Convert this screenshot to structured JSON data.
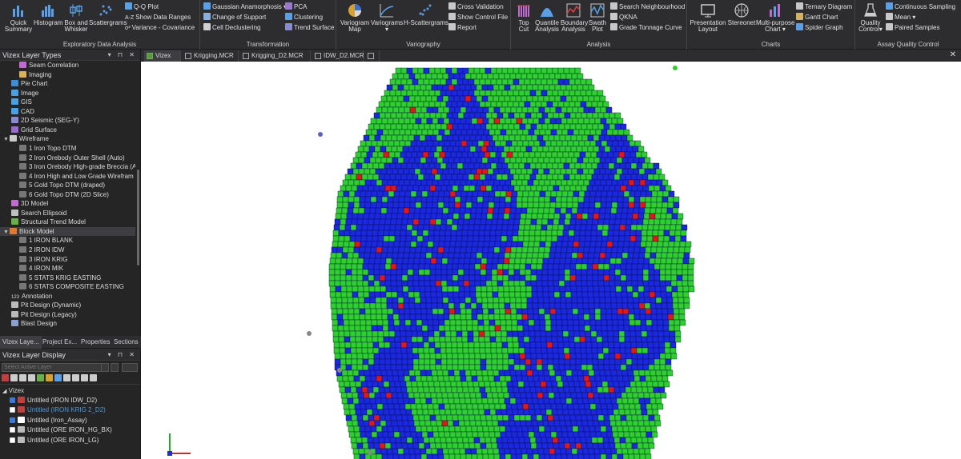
{
  "ribbon": {
    "eda": {
      "label": "Exploratory Data Analysis",
      "quick": "Quick",
      "quick2": "Summary",
      "histogram": "Histogram",
      "box": "Box and",
      "box2": "Whisker",
      "scatter": "Scattergrams",
      "qq": "Q-Q Plot",
      "ranges": "Show Data Ranges",
      "ranges_prefix": "A-Z",
      "varcov": "Variance - Covariance",
      "varcov_prefix": "σ²"
    },
    "transformation": {
      "label": "Transformation",
      "gauss": "Gaussian Anamorphosis",
      "support": "Change of Support",
      "declust": "Cell Declustering",
      "pca": "PCA",
      "clustering": "Clustering",
      "trend": "Trend Surface"
    },
    "variography": {
      "label": "Variography",
      "map": "Variogram",
      "map2": "Map",
      "variograms": "Variograms",
      "hscatter": "H-Scattergrams",
      "crossval": "Cross Validation",
      "control": "Show Control File",
      "report": "Report"
    },
    "analysis": {
      "label": "Analysis",
      "topcut": "Top",
      "topcut2": "Cut",
      "quantile": "Quantile",
      "quantile2": "Analysis",
      "boundary": "Boundary",
      "boundary2": "Analysis",
      "swath": "Swath",
      "swath2": "Plot",
      "search": "Search Neighbourhood",
      "qkna": "QKNA",
      "grade": "Grade Tonnage Curve"
    },
    "charts": {
      "label": "Charts",
      "presentation": "Presentation",
      "presentation2": "Layout",
      "stereonet": "Stereonet",
      "multi": "Multi-purpose",
      "multi2": "Chart",
      "ternary": "Ternary Diagram",
      "gantt": "Gantt Chart",
      "spider": "Spider Graph"
    },
    "aqc": {
      "label": "Assay Quality Control",
      "quality": "Quality",
      "quality2": "Control",
      "continuous": "Continuous Sampling",
      "mean": "Mean",
      "paired": "Paired Samples"
    }
  },
  "layer_types": {
    "title": "Vizex Layer Types",
    "controls": "▾ ⊓ ✕",
    "items": [
      {
        "label": "Seam Correlation",
        "indent": 2,
        "color": "#c06bd0"
      },
      {
        "label": "Imaging",
        "indent": 2,
        "color": "#d8b060"
      },
      {
        "label": "Pie Chart",
        "indent": 1,
        "color": "#3b8fd8"
      },
      {
        "label": "Image",
        "indent": 1,
        "color": "#4aa0e0"
      },
      {
        "label": "GIS",
        "indent": 1,
        "color": "#4aa0e0"
      },
      {
        "label": "CAD",
        "indent": 1,
        "color": "#4aa0e0"
      },
      {
        "label": "2D Seismic (SEG-Y)",
        "indent": 1,
        "color": "#8a8ad0"
      },
      {
        "label": "Grid Surface",
        "indent": 1,
        "color": "#9a6ad0"
      },
      {
        "label": "Wireframe",
        "indent": 0,
        "color": "#cccccc",
        "expanded": true
      },
      {
        "label": "1 Iron Topo DTM",
        "indent": 2,
        "color": "#777777"
      },
      {
        "label": "2 Iron Orebody Outer Shell (Auto)",
        "indent": 2,
        "color": "#777777"
      },
      {
        "label": "3 Iron Orebody High-grade Breccia (A",
        "indent": 2,
        "color": "#777777"
      },
      {
        "label": "4 Iron High and Low Grade Wirefram",
        "indent": 2,
        "color": "#777777"
      },
      {
        "label": "5 Gold Topo DTM (draped)",
        "indent": 2,
        "color": "#777777"
      },
      {
        "label": "6 Gold Topo DTM (2D Slice)",
        "indent": 2,
        "color": "#777777"
      },
      {
        "label": "3D Model",
        "indent": 1,
        "color": "#c06bd0"
      },
      {
        "label": "Search Ellipsoid",
        "indent": 1,
        "color": "#c0c0c0"
      },
      {
        "label": "Structural Trend Model",
        "indent": 1,
        "color": "#6ab04a"
      },
      {
        "label": "Block Model",
        "indent": 0,
        "color": "#e07a30",
        "expanded": true,
        "selected": true
      },
      {
        "label": "1 IRON BLANK",
        "indent": 2,
        "color": "#777777"
      },
      {
        "label": "2 IRON IDW",
        "indent": 2,
        "color": "#777777"
      },
      {
        "label": "3 IRON KRIG",
        "indent": 2,
        "color": "#777777"
      },
      {
        "label": "4 IRON MIK",
        "indent": 2,
        "color": "#777777"
      },
      {
        "label": "5 STATS KRIG EASTING",
        "indent": 2,
        "color": "#777777"
      },
      {
        "label": "6 STATS COMPOSITE EASTING",
        "indent": 2,
        "color": "#777777"
      },
      {
        "label": "Annotation",
        "indent": 1,
        "color": "#aaaaaa",
        "prefix": "123"
      },
      {
        "label": "Pit Design (Dynamic)",
        "indent": 1,
        "color": "#bbbbbb"
      },
      {
        "label": "Pit Design (Legacy)",
        "indent": 1,
        "color": "#bbbbbb"
      },
      {
        "label": "Blast Design",
        "indent": 1,
        "color": "#8aa0d0"
      }
    ]
  },
  "panel_tabs": [
    "Vizex Laye...",
    "Project Ex...",
    "Properties",
    "Sections"
  ],
  "layer_display": {
    "title": "Vizex Layer Display",
    "controls": "▾ ⊓ ✕",
    "select_placeholder": "Select Active Layer",
    "root": "Vizex",
    "layers": [
      {
        "label": "Untitled (IRON IDW_D2)",
        "checked": true,
        "color": "#dddddd",
        "icon": "#c04040"
      },
      {
        "label": "Untitled (IRON KRIG 2_D2)",
        "checked": false,
        "color": "#4a9ae0",
        "icon": "#c04040"
      },
      {
        "label": "Untitled (Iron_Assay)",
        "checked": true,
        "color": "#dddddd",
        "icon": "#ffffff"
      },
      {
        "label": "Untitled (ORE IRON_HG_BX)",
        "checked": false,
        "color": "#dddddd",
        "icon": "#bbbbbb"
      },
      {
        "label": "Untitled (ORE IRON_LG)",
        "checked": false,
        "color": "#dddddd",
        "icon": "#bbbbbb"
      }
    ]
  },
  "doc_tabs": [
    {
      "label": "Vizex",
      "active": true
    },
    {
      "label": "Krigging.MCR",
      "active": false
    },
    {
      "label": "Krigging_D2.MCR",
      "active": false
    },
    {
      "label": "IDW_D2.MCR",
      "active": false
    }
  ],
  "close_glyph": "✕",
  "colors": {
    "green": "#2ed02e",
    "blue": "#1a28e0",
    "red": "#e01818",
    "accent": "#3b78d8"
  }
}
